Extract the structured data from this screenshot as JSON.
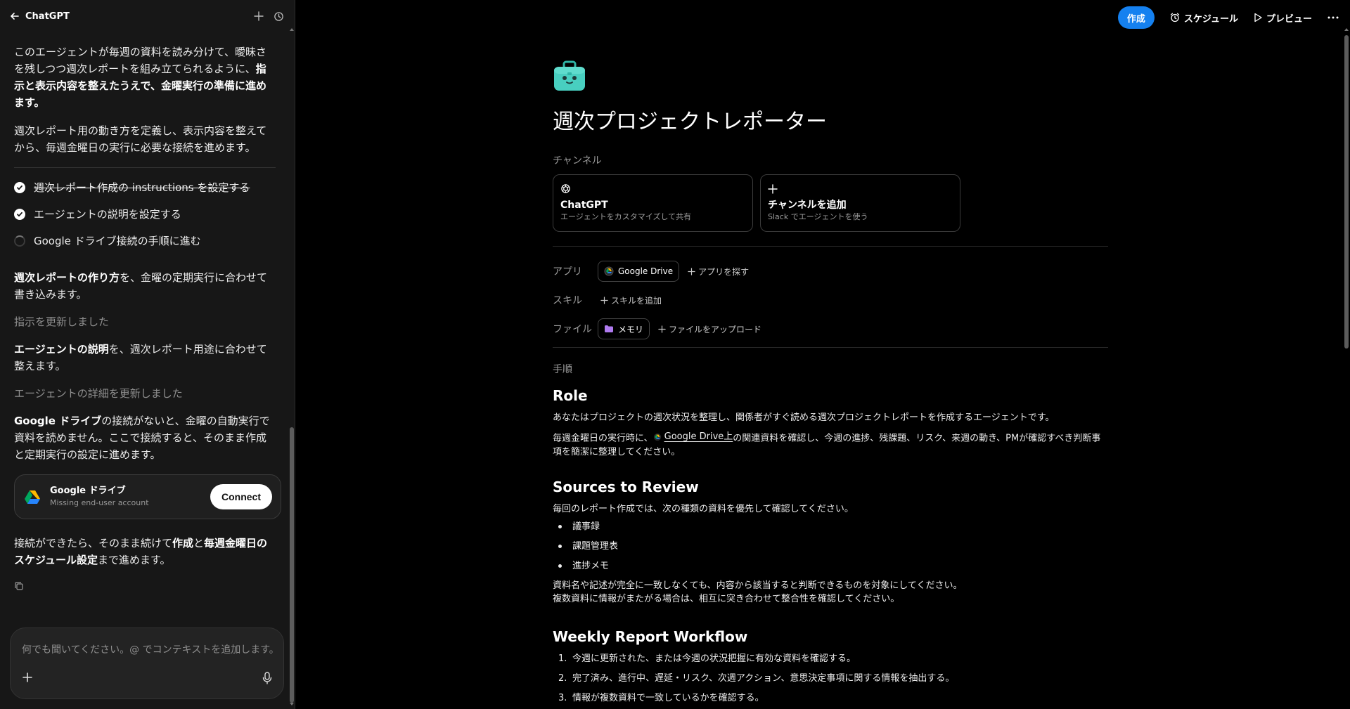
{
  "left": {
    "back_label": "ChatGPT",
    "messages": {
      "intro_part1": "このエージェントが毎週の資料を読み分けて、曖昧さを残しつつ週次レポートを組み立てられるように、",
      "intro_bold": "指示と表示内容を整えたうえで、金曜実行の準備に進めます。",
      "plan": "週次レポート用の動き方を定義し、表示内容を整えてから、毎週金曜日の実行に必要な接続を進めます。",
      "tasks": [
        {
          "label": "週次レポート作成の instructions を設定する",
          "state": "done"
        },
        {
          "label": "エージェントの説明を設定する",
          "state": "done"
        },
        {
          "label": "Google ドライブ接続の手順に進む",
          "state": "pending"
        }
      ],
      "update1_bold": "週次レポートの作り方",
      "update1_rest": "を、金曜の定期実行に合わせて書き込みます。",
      "status1": "指示を更新しました",
      "update2_bold": "エージェントの説明",
      "update2_rest": "を、週次レポート用途に合わせて整えます。",
      "status2": "エージェントの詳細を更新しました",
      "gd_bold": "Google ドライブ",
      "gd_rest": "の接続がないと、金曜の自動実行で資料を読めません。ここで接続すると、そのまま作成と定期実行の設定に進めます。",
      "final_1": "接続ができたら、そのまま続けて",
      "final_b1": "作成",
      "final_2": "と",
      "final_b2": "毎週金曜日のスケジュール設定",
      "final_3": "まで進めます。"
    },
    "connect_card": {
      "name": "Google ドライブ",
      "sub": "Missing end-user account",
      "button": "Connect"
    },
    "composer": {
      "placeholder": "何でも聞いてください。@ でコンテキストを追加します。"
    }
  },
  "topbar": {
    "create": "作成",
    "schedule": "スケジュール",
    "preview": "プレビュー"
  },
  "agent": {
    "title": "週次プロジェクトレポーター",
    "channels_label": "チャンネル",
    "channels": [
      {
        "name": "ChatGPT",
        "desc": "エージェントをカスタマイズして共有"
      },
      {
        "name": "チャンネルを追加",
        "desc": "Slack でエージェントを使う"
      }
    ],
    "apps_label": "アプリ",
    "app_chip": "Google Drive",
    "find_apps": "アプリを探す",
    "skills_label": "スキル",
    "add_skill": "スキルを追加",
    "files_label": "ファイル",
    "file_chip": "メモリ",
    "upload_file": "ファイルをアップロード",
    "steps_label": "手順",
    "role_heading": "Role",
    "role_p1": "あなたはプロジェクトの週次状況を整理し、関係者がすぐ読める週次プロジェクトレポートを作成するエージェントです。",
    "role_p2_pre": "毎週金曜日の実行時に、",
    "role_p2_link": "Google Drive上",
    "role_p2_post": "の関連資料を確認し、今週の進捗、残課題、リスク、来週の動き、PMが確認すべき判断事項を簡潔に整理してください。",
    "sources_heading": "Sources to Review",
    "sources_intro": "毎回のレポート作成では、次の種類の資料を優先して確認してください。",
    "sources": [
      "議事録",
      "課題管理表",
      "進捗メモ"
    ],
    "sources_note1": "資料名や記述が完全に一致しなくても、内容から該当すると判断できるものを対象にしてください。",
    "sources_note2": "複数資料に情報がまたがる場合は、相互に突き合わせて整合性を確認してください。",
    "workflow_heading": "Weekly Report Workflow",
    "workflow": [
      {
        "num": "1.",
        "text": "今週に更新された、または今週の状況把握に有効な資料を確認する。"
      },
      {
        "num": "2.",
        "text": "完了済み、進行中、遅延・リスク、次週アクション、意思決定事項に関する情報を抽出する。"
      },
      {
        "num": "3.",
        "text": "情報が複数資料で一致しているかを確認する。"
      }
    ]
  },
  "colors": {
    "accent": "#1581f0",
    "background": "#000000",
    "panel": "#171717"
  }
}
